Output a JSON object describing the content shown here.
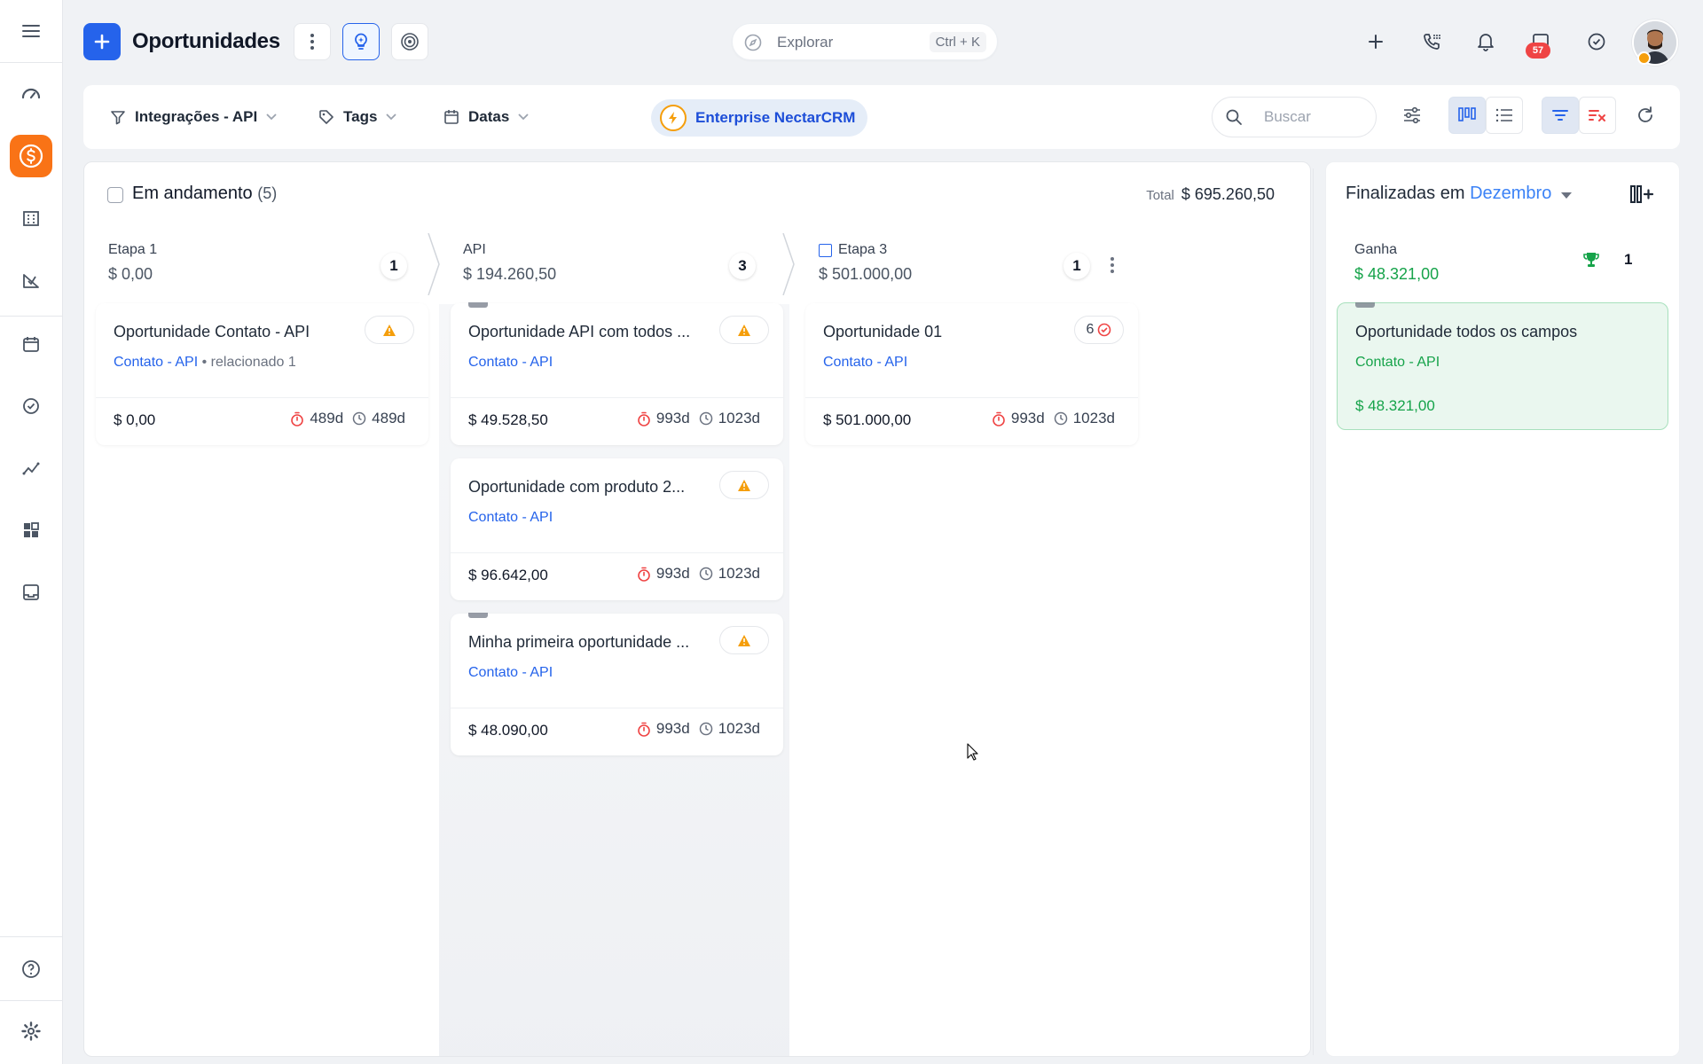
{
  "header": {
    "title": "Oportunidades",
    "explore_placeholder": "Explorar",
    "explore_shortcut": "Ctrl + K",
    "notifications_count": "57"
  },
  "filters": {
    "pipeline": "Integrações - API",
    "tags": "Tags",
    "dates": "Datas",
    "enterprise": "Enterprise NectarCRM",
    "search_placeholder": "Buscar"
  },
  "pipeline": {
    "title": "Em andamento",
    "count": "(5)",
    "total_label": "Total",
    "total_value": "$ 695.260,50",
    "stages": [
      {
        "name": "Etapa 1",
        "value": "$ 0,00",
        "count": "1",
        "cards": [
          {
            "title": "Oportunidade Contato - API",
            "contact": "Contato - API",
            "related": "• relacionado 1",
            "value": "$ 0,00",
            "time1": "489d",
            "time2": "489d"
          }
        ]
      },
      {
        "name": "API",
        "value": "$ 194.260,50",
        "count": "3",
        "cards": [
          {
            "title": "Oportunidade API com todos ...",
            "contact": "Contato - API",
            "value": "$ 49.528,50",
            "time1": "993d",
            "time2": "1023d"
          },
          {
            "title": "Oportunidade com produto 2...",
            "contact": "Contato - API",
            "value": "$ 96.642,00",
            "time1": "993d",
            "time2": "1023d"
          },
          {
            "title": "Minha primeira oportunidade ...",
            "contact": "Contato - API",
            "value": "$ 48.090,00",
            "time1": "993d",
            "time2": "1023d"
          }
        ]
      },
      {
        "name": "Etapa 3",
        "value": "$ 501.000,00",
        "count": "1",
        "cards": [
          {
            "title": "Oportunidade 01",
            "contact": "Contato - API",
            "tasks": "6",
            "value": "$ 501.000,00",
            "time1": "993d",
            "time2": "1023d"
          }
        ]
      }
    ]
  },
  "finalized": {
    "title": "Finalizadas em",
    "month": "Dezembro",
    "won_label": "Ganha",
    "won_value": "$ 48.321,00",
    "won_count": "1",
    "won_card": {
      "title": "Oportunidade todos os campos",
      "contact": "Contato - API",
      "value": "$ 48.321,00"
    }
  },
  "colors": {
    "accent": "#2563eb",
    "active_nav": "#f97316",
    "won": "#16a34a",
    "warning": "#f59e0b",
    "timer": "#ef4444"
  }
}
